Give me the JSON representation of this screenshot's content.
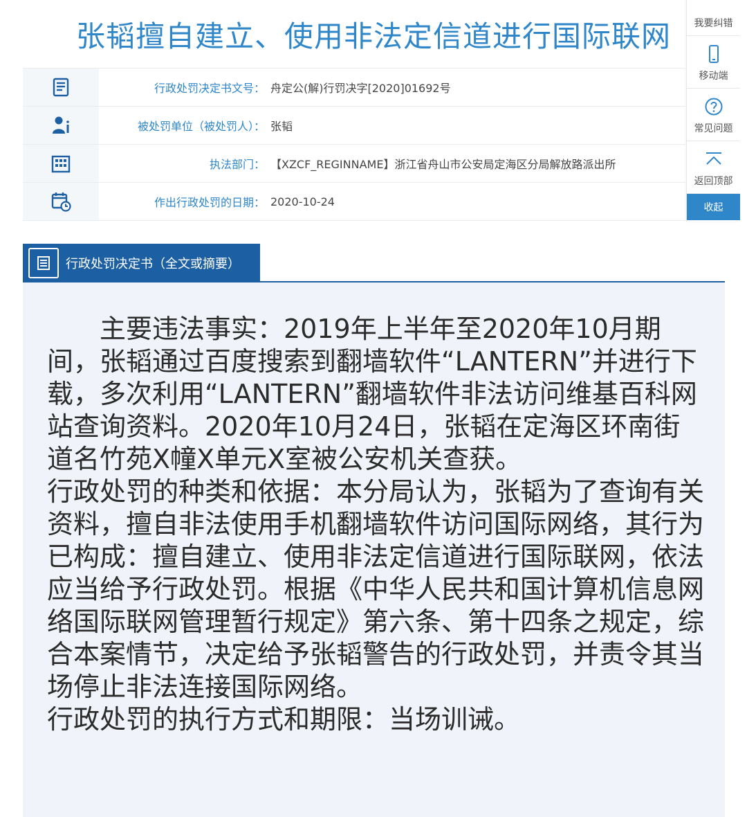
{
  "title": "张韬擅自建立、使用非法定信道进行国际联网",
  "info": [
    {
      "icon": "document-list-icon",
      "label": "行政处罚决定书文号：",
      "value": "舟定公(解)行罚决字[2020]01692号"
    },
    {
      "icon": "person-info-icon",
      "label": "被处罚单位（被处罚人）：",
      "value": "张韬"
    },
    {
      "icon": "building-icon",
      "label": "执法部门：",
      "value": "【XZCF_REGINNAME】浙江省舟山市公安局定海区分局解放路派出所"
    },
    {
      "icon": "calendar-clock-icon",
      "label": "作出行政处罚的日期：",
      "value": "2020-10-24"
    }
  ],
  "toolbar": {
    "report_error": "我要纠错",
    "mobile": "移动端",
    "faq": "常见问题",
    "back_to_top": "返回顶部",
    "collapse": "收起"
  },
  "section": {
    "title": "行政处罚决定书（全文或摘要）"
  },
  "body": {
    "para1": "主要违法事实：2019年上半年至2020年10月期间，张韬通过百度搜索到翻墙软件“LANTERN”并进行下载，多次利用“LANTERN”翻墙软件非法访问维基百科网站查询资料。2020年10月24日，张韬在定海区环南街道名竹苑X幢X单元X室被公安机关查获。",
    "para2": "行政处罚的种类和依据：本分局认为，张韬为了查询有关资料，擅自非法使用手机翻墙软件访问国际网络，其行为已构成：擅自建立、使用非法定信道进行国际联网，依法应当给予行政处罚。根据《中华人民共和国计算机信息网络国际联网管理暂行规定》第六条、第十四条之规定，综合本案情节，决定给予张韬警告的行政处罚，并责令其当场停止非法连接国际网络。",
    "para3": "行政处罚的执行方式和期限：当场训诫。"
  },
  "colors": {
    "accent": "#2f86c9",
    "section_header": "#1d5fa3",
    "body_bg": "#f0f4fa"
  }
}
